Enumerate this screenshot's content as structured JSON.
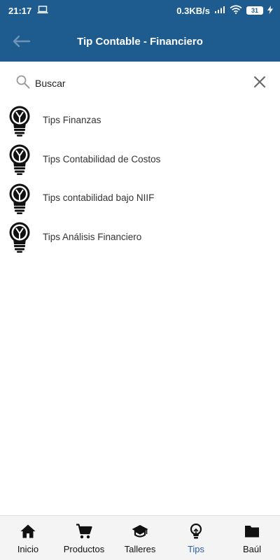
{
  "status_bar": {
    "time": "21:17",
    "network_speed": "0.3KB/s",
    "battery_level": "31",
    "icons": [
      "laptop-icon",
      "signal-icon",
      "wifi-icon",
      "battery-icon",
      "charging-icon"
    ]
  },
  "app_bar": {
    "title": "Tip Contable - Financiero",
    "background_color": "#1e5b8f"
  },
  "search": {
    "value": "Buscar"
  },
  "tips": [
    {
      "label": "Tips Finanzas"
    },
    {
      "label": "Tips Contabilidad de Costos"
    },
    {
      "label": "Tips contabilidad bajo NIIF"
    },
    {
      "label": "Tips Análisis Financiero"
    }
  ],
  "bottom_nav": {
    "items": [
      {
        "label": "Inicio",
        "icon": "home-icon",
        "active": false
      },
      {
        "label": "Productos",
        "icon": "cart-icon",
        "active": false
      },
      {
        "label": "Talleres",
        "icon": "graduation-cap-icon",
        "active": false
      },
      {
        "label": "Tips",
        "icon": "lightbulb-icon",
        "active": true
      },
      {
        "label": "Baúl",
        "icon": "folder-icon",
        "active": false
      }
    ],
    "active_color": "#2a5db0"
  }
}
